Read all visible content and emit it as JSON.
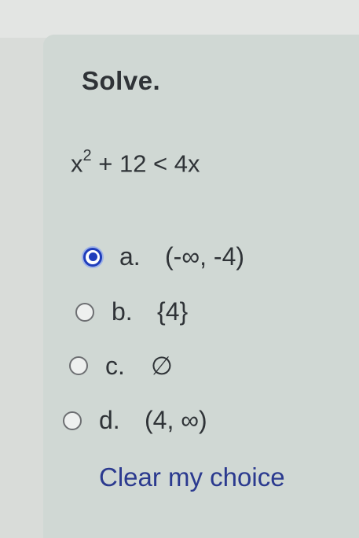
{
  "question": {
    "title": "Solve.",
    "equation": {
      "base": "x",
      "exponent": "2",
      "rest": " + 12 < 4x"
    }
  },
  "options": [
    {
      "letter": "a.",
      "value": "(-∞, -4)",
      "selected": true
    },
    {
      "letter": "b.",
      "value": "{4}",
      "selected": false
    },
    {
      "letter": "c.",
      "value": "∅",
      "selected": false
    },
    {
      "letter": "d.",
      "value": "(4, ∞)",
      "selected": false
    }
  ],
  "clear_label": "Clear my choice",
  "colors": {
    "selected_radio": "#1f3dbb",
    "link": "#2b3a8f",
    "panel_background": "#d0d8d4"
  }
}
